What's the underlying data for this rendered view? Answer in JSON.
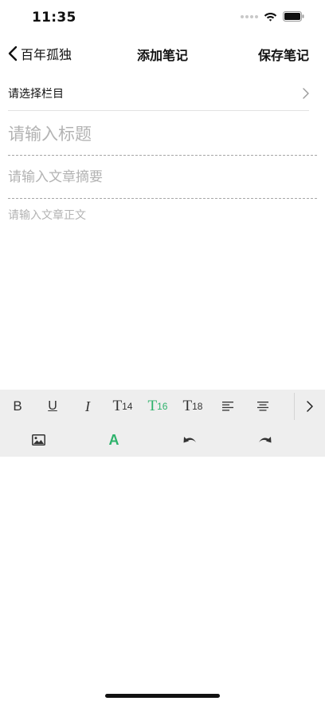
{
  "status_bar": {
    "time": "11:35"
  },
  "nav": {
    "back_label": "百年孤独",
    "title": "添加笔记",
    "save_label": "保存笔记"
  },
  "category": {
    "label": "请选择栏目"
  },
  "form": {
    "title_placeholder": "请输入标题",
    "summary_placeholder": "请输入文章摘要",
    "body_placeholder": "请输入文章正文"
  },
  "toolbar": {
    "bold_label": "B",
    "underline_label": "U",
    "italic_label": "I",
    "sizes": [
      {
        "letter": "T",
        "size": "14",
        "active": false
      },
      {
        "letter": "T",
        "size": "16",
        "active": true
      },
      {
        "letter": "T",
        "size": "18",
        "active": false
      }
    ],
    "font_color_label": "A",
    "accent_color": "#2db26b",
    "icons": [
      "align-left-icon",
      "align-center-icon",
      "chevron-right-icon",
      "image-icon",
      "undo-icon",
      "redo-icon"
    ]
  }
}
